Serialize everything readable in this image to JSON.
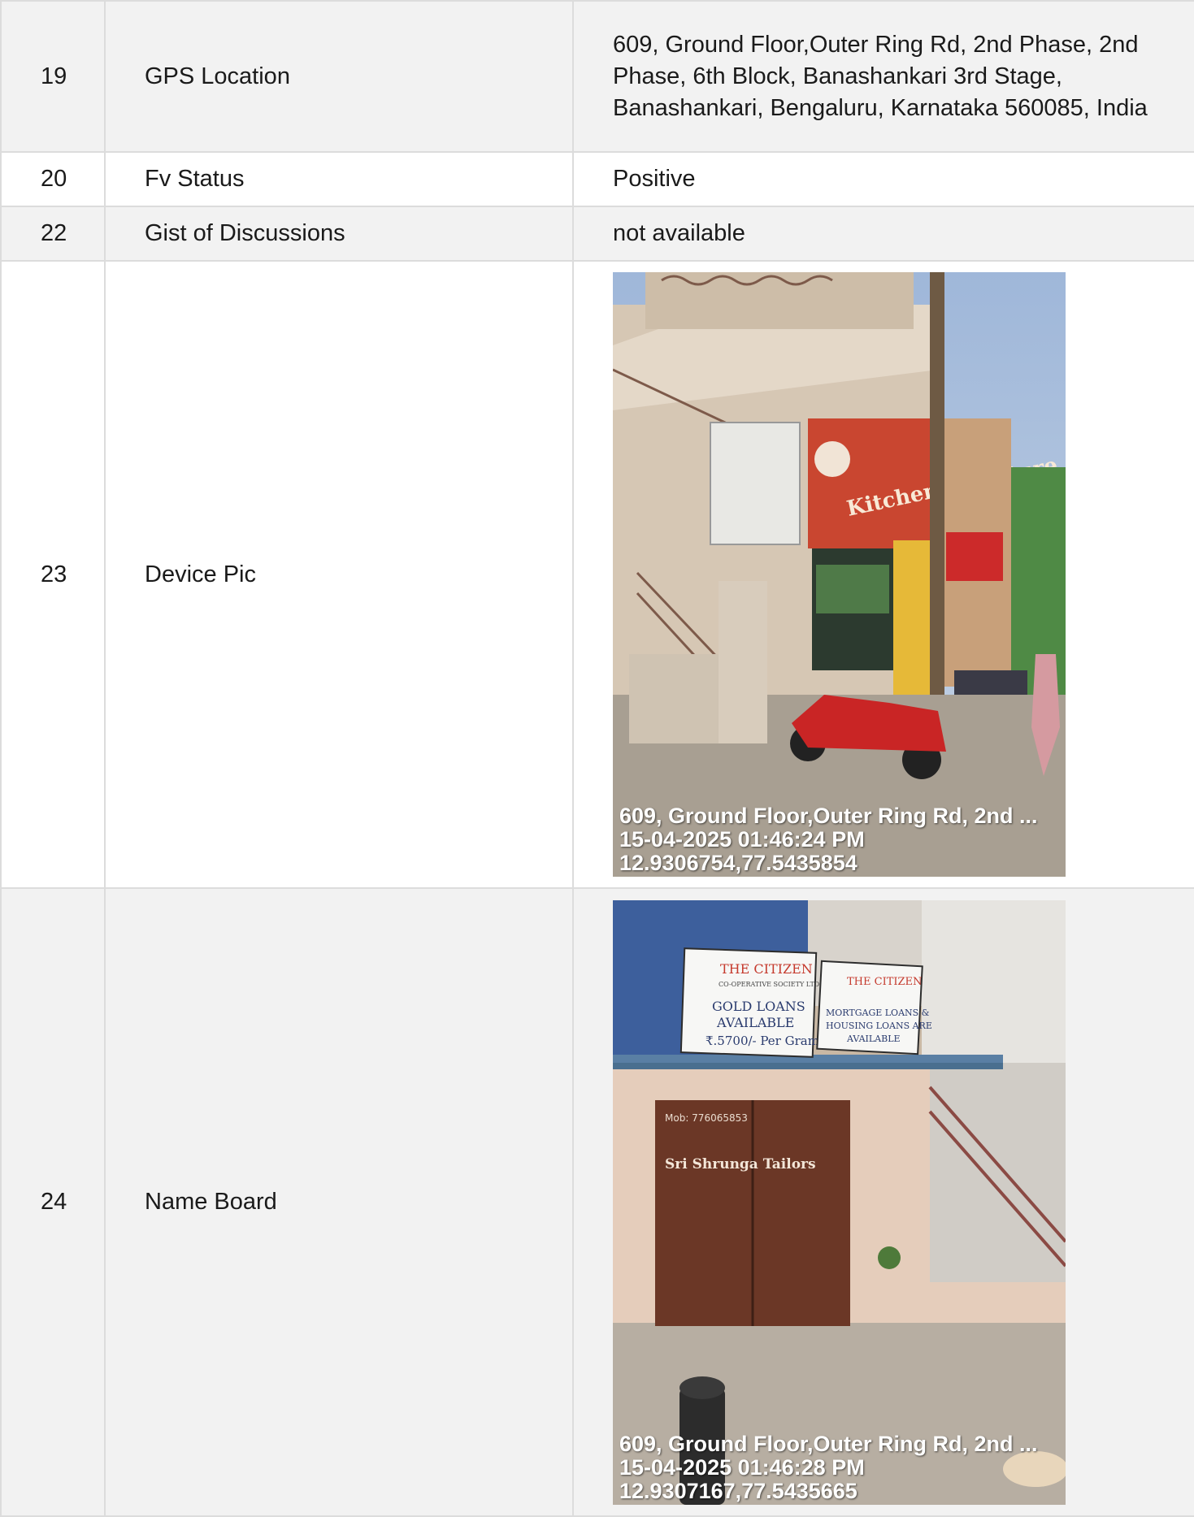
{
  "rows": [
    {
      "no": "19",
      "label": "GPS Location",
      "value": "609, Ground Floor,Outer Ring Rd, 2nd Phase, 2nd Phase, 6th Block, Banashankari 3rd Stage, Banashankari, Bengaluru, Karnataka 560085, India"
    },
    {
      "no": "20",
      "label": "Fv Status",
      "value": "Positive"
    },
    {
      "no": "22",
      "label": "Gist of Discussions",
      "value": "not available"
    },
    {
      "no": "23",
      "label": "Device Pic",
      "photo": {
        "address": "609, Ground Floor,Outer Ring Rd, 2nd ...",
        "datetime": "15-04-2025 01:46:24 PM",
        "coords": "12.9306754,77.5435854",
        "shop_sign": "Kitchen Furniture"
      }
    },
    {
      "no": "24",
      "label": "Name Board",
      "photo": {
        "address": "609, Ground Floor,Outer Ring Rd, 2nd ...",
        "datetime": "15-04-2025 01:46:28 PM",
        "coords": "12.9307167,77.5435665",
        "sign1_title": "THE CITIZEN",
        "sign1_sub": "CO-OPERATIVE SOCIETY LTD.",
        "sign1_line1": "GOLD LOANS",
        "sign1_line2": "AVAILABLE",
        "sign1_line3": "₹.5700/- Per Gram",
        "sign2_title": "THE CITIZEN",
        "sign2_line1": "MORTGAGE LOANS &",
        "sign2_line2": "HOUSING LOANS ARE",
        "sign2_line3": "AVAILABLE",
        "door_mob": "Mob: 776065853",
        "door_name": "Sri Shrunga Tailors"
      }
    }
  ],
  "colors": {
    "border": "#dcdcdc",
    "shade": "#f2f2f2",
    "text": "#1a1a1a",
    "stamp": "#ffffff"
  }
}
